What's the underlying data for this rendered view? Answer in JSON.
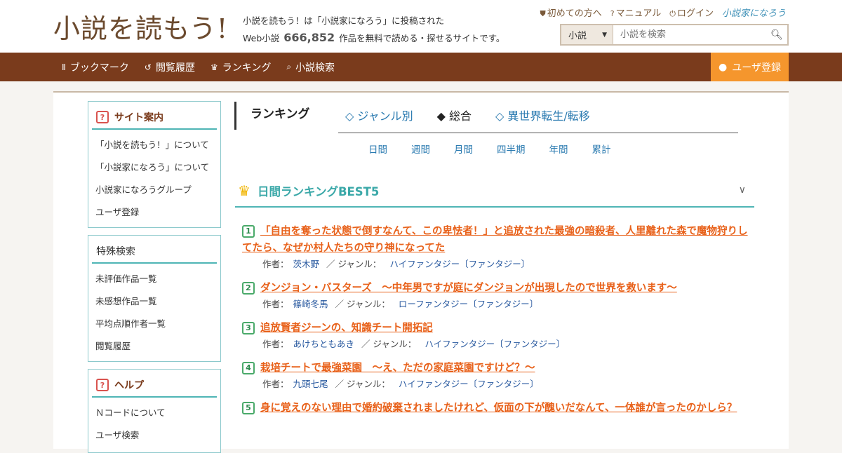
{
  "header": {
    "logo": "小説を読もう!",
    "tagline_line1": "小説を読もう！は「小説家になろう」に投稿された",
    "tagline_pre": "Web小説",
    "work_count": "666,852",
    "tagline_post": "作品を無料で読める・探せるサイトです。",
    "links": {
      "first_time": "初めての方へ",
      "manual": "マニュアル",
      "login": "ログイン",
      "narou": "小説家になろう"
    },
    "search": {
      "category": "小説",
      "placeholder": "小説を検索"
    }
  },
  "nav": {
    "items": [
      {
        "label": "ブックマーク",
        "icon": "bookmark-icon"
      },
      {
        "label": "閲覧履歴",
        "icon": "history-icon"
      },
      {
        "label": "ランキング",
        "icon": "crown-icon"
      },
      {
        "label": "小説検索",
        "icon": "search-icon"
      }
    ],
    "register": "ユーザ登録"
  },
  "sidebar": {
    "site_guide": {
      "title": "サイト案内",
      "items": [
        "「小説を読もう！」について",
        "「小説家になろう」について",
        "小説家になろうグループ",
        "ユーザ登録"
      ]
    },
    "special_search": {
      "title": "特殊検索",
      "items": [
        "未評価作品一覧",
        "未感想作品一覧",
        "平均点順作者一覧",
        "閲覧履歴"
      ]
    },
    "help": {
      "title": "ヘルプ",
      "items": [
        "Ｎコードについて",
        "ユーザ検索"
      ]
    }
  },
  "ranking": {
    "title": "ランキング",
    "genre_tabs": [
      {
        "label": "◇ ジャンル別",
        "active": false
      },
      {
        "label": "◆ 総合",
        "active": true
      },
      {
        "label": "◇ 異世界転生/転移",
        "active": false
      }
    ],
    "period_tabs": [
      "日間",
      "週間",
      "月間",
      "四半期",
      "年間",
      "累計"
    ],
    "best_title": "日間ランキングBEST5",
    "author_label": "作者：",
    "genre_label": "／ ジャンル：",
    "entries": [
      {
        "rank": "1",
        "title": "「自由を奪った状態で倒すなんて、この卑怯者！」と追放された最強の暗殺者、人里離れた森で魔物狩りしてたら、なぜか村人たちの守り神になってた",
        "author": "茨木野",
        "genre": "ハイファンタジー〔ファンタジー〕"
      },
      {
        "rank": "2",
        "title": "ダンジョン・バスターズ　～中年男ですが庭にダンジョンが出現したので世界を救います～",
        "author": "篠崎冬馬",
        "genre": "ローファンタジー〔ファンタジー〕"
      },
      {
        "rank": "3",
        "title": "追放賢者ジーンの、知識チート開拓記",
        "author": "あけちともあき",
        "genre": "ハイファンタジー〔ファンタジー〕"
      },
      {
        "rank": "4",
        "title": "栽培チートで最強菜園　～え、ただの家庭菜園ですけど？～",
        "author": "九頭七尾",
        "genre": "ハイファンタジー〔ファンタジー〕"
      },
      {
        "rank": "5",
        "title": "身に覚えのない理由で婚約破棄されましたけれど、仮面の下が醜いだなんて、一体誰が言ったのかしら？",
        "author": "",
        "genre": ""
      }
    ]
  }
}
